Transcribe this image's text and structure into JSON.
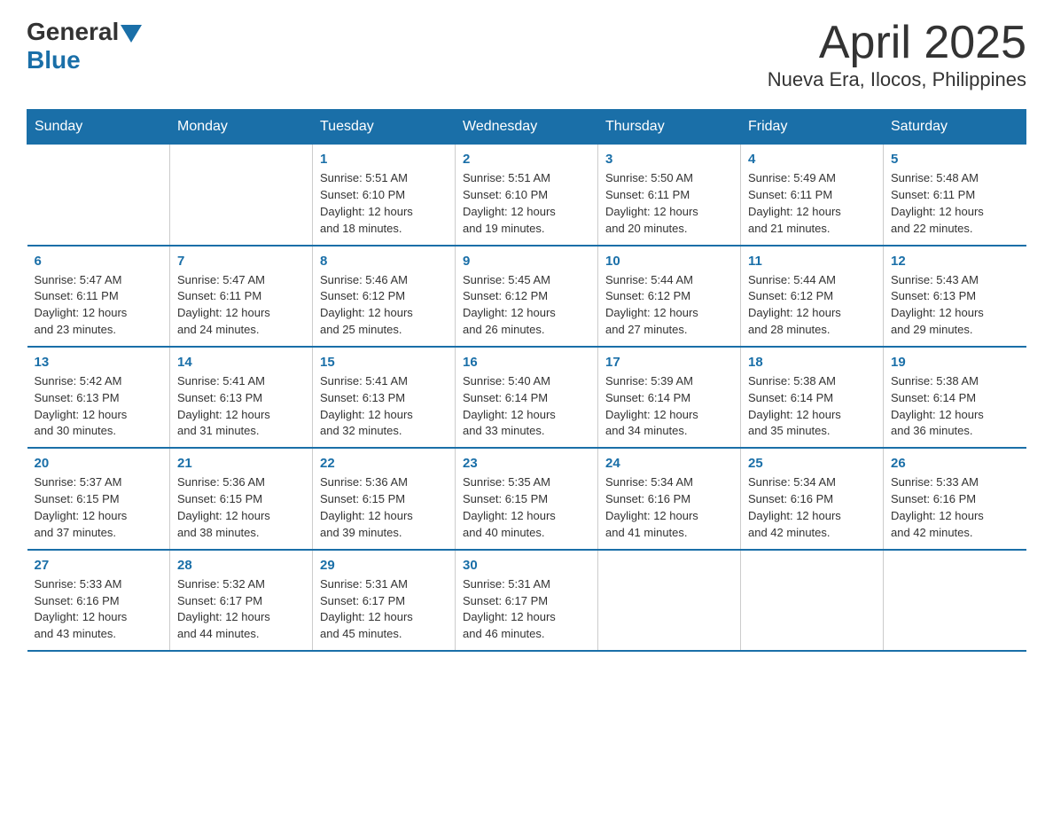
{
  "header": {
    "logo_general": "General",
    "logo_blue": "Blue",
    "title": "April 2025",
    "subtitle": "Nueva Era, Ilocos, Philippines"
  },
  "days_of_week": [
    "Sunday",
    "Monday",
    "Tuesday",
    "Wednesday",
    "Thursday",
    "Friday",
    "Saturday"
  ],
  "weeks": [
    [
      {
        "day": "",
        "info": ""
      },
      {
        "day": "",
        "info": ""
      },
      {
        "day": "1",
        "info": "Sunrise: 5:51 AM\nSunset: 6:10 PM\nDaylight: 12 hours\nand 18 minutes."
      },
      {
        "day": "2",
        "info": "Sunrise: 5:51 AM\nSunset: 6:10 PM\nDaylight: 12 hours\nand 19 minutes."
      },
      {
        "day": "3",
        "info": "Sunrise: 5:50 AM\nSunset: 6:11 PM\nDaylight: 12 hours\nand 20 minutes."
      },
      {
        "day": "4",
        "info": "Sunrise: 5:49 AM\nSunset: 6:11 PM\nDaylight: 12 hours\nand 21 minutes."
      },
      {
        "day": "5",
        "info": "Sunrise: 5:48 AM\nSunset: 6:11 PM\nDaylight: 12 hours\nand 22 minutes."
      }
    ],
    [
      {
        "day": "6",
        "info": "Sunrise: 5:47 AM\nSunset: 6:11 PM\nDaylight: 12 hours\nand 23 minutes."
      },
      {
        "day": "7",
        "info": "Sunrise: 5:47 AM\nSunset: 6:11 PM\nDaylight: 12 hours\nand 24 minutes."
      },
      {
        "day": "8",
        "info": "Sunrise: 5:46 AM\nSunset: 6:12 PM\nDaylight: 12 hours\nand 25 minutes."
      },
      {
        "day": "9",
        "info": "Sunrise: 5:45 AM\nSunset: 6:12 PM\nDaylight: 12 hours\nand 26 minutes."
      },
      {
        "day": "10",
        "info": "Sunrise: 5:44 AM\nSunset: 6:12 PM\nDaylight: 12 hours\nand 27 minutes."
      },
      {
        "day": "11",
        "info": "Sunrise: 5:44 AM\nSunset: 6:12 PM\nDaylight: 12 hours\nand 28 minutes."
      },
      {
        "day": "12",
        "info": "Sunrise: 5:43 AM\nSunset: 6:13 PM\nDaylight: 12 hours\nand 29 minutes."
      }
    ],
    [
      {
        "day": "13",
        "info": "Sunrise: 5:42 AM\nSunset: 6:13 PM\nDaylight: 12 hours\nand 30 minutes."
      },
      {
        "day": "14",
        "info": "Sunrise: 5:41 AM\nSunset: 6:13 PM\nDaylight: 12 hours\nand 31 minutes."
      },
      {
        "day": "15",
        "info": "Sunrise: 5:41 AM\nSunset: 6:13 PM\nDaylight: 12 hours\nand 32 minutes."
      },
      {
        "day": "16",
        "info": "Sunrise: 5:40 AM\nSunset: 6:14 PM\nDaylight: 12 hours\nand 33 minutes."
      },
      {
        "day": "17",
        "info": "Sunrise: 5:39 AM\nSunset: 6:14 PM\nDaylight: 12 hours\nand 34 minutes."
      },
      {
        "day": "18",
        "info": "Sunrise: 5:38 AM\nSunset: 6:14 PM\nDaylight: 12 hours\nand 35 minutes."
      },
      {
        "day": "19",
        "info": "Sunrise: 5:38 AM\nSunset: 6:14 PM\nDaylight: 12 hours\nand 36 minutes."
      }
    ],
    [
      {
        "day": "20",
        "info": "Sunrise: 5:37 AM\nSunset: 6:15 PM\nDaylight: 12 hours\nand 37 minutes."
      },
      {
        "day": "21",
        "info": "Sunrise: 5:36 AM\nSunset: 6:15 PM\nDaylight: 12 hours\nand 38 minutes."
      },
      {
        "day": "22",
        "info": "Sunrise: 5:36 AM\nSunset: 6:15 PM\nDaylight: 12 hours\nand 39 minutes."
      },
      {
        "day": "23",
        "info": "Sunrise: 5:35 AM\nSunset: 6:15 PM\nDaylight: 12 hours\nand 40 minutes."
      },
      {
        "day": "24",
        "info": "Sunrise: 5:34 AM\nSunset: 6:16 PM\nDaylight: 12 hours\nand 41 minutes."
      },
      {
        "day": "25",
        "info": "Sunrise: 5:34 AM\nSunset: 6:16 PM\nDaylight: 12 hours\nand 42 minutes."
      },
      {
        "day": "26",
        "info": "Sunrise: 5:33 AM\nSunset: 6:16 PM\nDaylight: 12 hours\nand 42 minutes."
      }
    ],
    [
      {
        "day": "27",
        "info": "Sunrise: 5:33 AM\nSunset: 6:16 PM\nDaylight: 12 hours\nand 43 minutes."
      },
      {
        "day": "28",
        "info": "Sunrise: 5:32 AM\nSunset: 6:17 PM\nDaylight: 12 hours\nand 44 minutes."
      },
      {
        "day": "29",
        "info": "Sunrise: 5:31 AM\nSunset: 6:17 PM\nDaylight: 12 hours\nand 45 minutes."
      },
      {
        "day": "30",
        "info": "Sunrise: 5:31 AM\nSunset: 6:17 PM\nDaylight: 12 hours\nand 46 minutes."
      },
      {
        "day": "",
        "info": ""
      },
      {
        "day": "",
        "info": ""
      },
      {
        "day": "",
        "info": ""
      }
    ]
  ]
}
